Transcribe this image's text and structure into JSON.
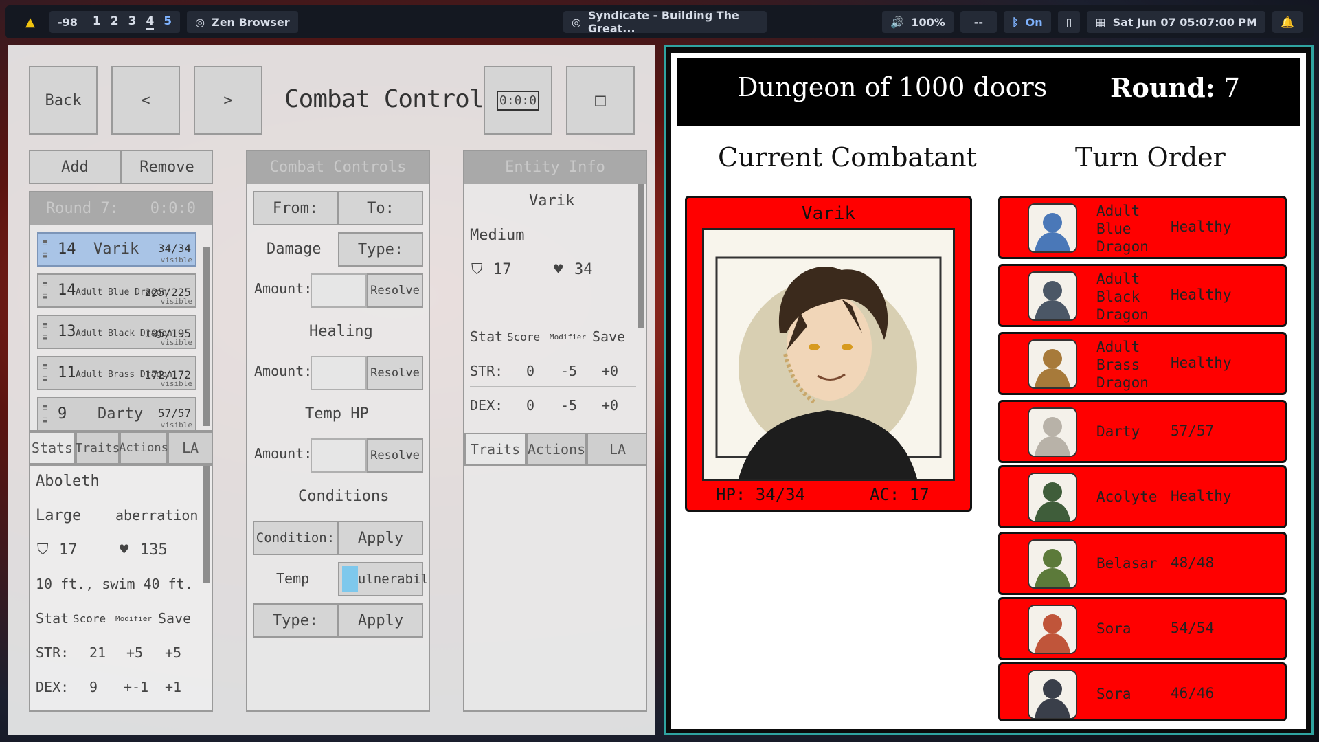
{
  "topbar": {
    "workspace_offset": "-98",
    "workspaces": [
      "1",
      "2",
      "3",
      "4",
      "5"
    ],
    "browser_label": "Zen Browser",
    "window_title": "Syndicate - Building The Great...",
    "volume": "100%",
    "net": "--",
    "bluetooth": "On",
    "datetime": "Sat Jun 07  05:07:00 PM"
  },
  "left": {
    "back": "Back",
    "prev": "<",
    "next": ">",
    "title": "Combat Control",
    "timer_icon_text": "0:0:0",
    "add": "Add",
    "remove": "Remove",
    "round_label": "Round 7:",
    "round_time": "0:0:0",
    "entities": [
      {
        "init": "14",
        "name": "Varik",
        "hp": "34/34",
        "visible": "visible",
        "selected": true
      },
      {
        "init": "14",
        "name": "Adult Blue Dragon",
        "hp": "225/225",
        "visible": "visible"
      },
      {
        "init": "13",
        "name": "Adult Black Dragon",
        "hp": "195/195",
        "visible": "visible"
      },
      {
        "init": "11",
        "name": "Adult Brass Dragon",
        "hp": "172/172",
        "visible": "visible"
      },
      {
        "init": "9",
        "name": "Darty",
        "hp": "57/57",
        "visible": "visible"
      }
    ],
    "tabs_left": [
      "Stats",
      "Traits",
      "Actions",
      "LA"
    ],
    "stats": {
      "name": "Aboleth",
      "size": "Large",
      "type": "aberration",
      "ac": "17",
      "hp": "135",
      "speed": "10 ft., swim 40 ft.",
      "head": [
        "Stat",
        "Score",
        "Modifier",
        "Save"
      ],
      "rows": [
        [
          "STR:",
          "21",
          "+5",
          "+5"
        ],
        [
          "DEX:",
          "9",
          "+-1",
          "+1"
        ]
      ]
    },
    "combat": {
      "head": "Combat Controls",
      "from": "From:",
      "to": "To:",
      "damage": "Damage",
      "type": "Type:",
      "amount": "Amount:",
      "resolve": "Resolve",
      "healing": "Healing",
      "temp_hp": "Temp HP",
      "conditions": "Conditions",
      "condition": "Condition:",
      "apply": "Apply",
      "temp_vuln_a": "Temp",
      "temp_vuln_b": "ulnerability",
      "type2": "Type:"
    },
    "entity": {
      "head": "Entity Info",
      "name": "Varik",
      "size": "Medium",
      "ac": "17",
      "hp": "34",
      "head_row": [
        "Stat",
        "Score",
        "Modifier",
        "Save"
      ],
      "rows": [
        [
          "STR:",
          "0",
          "-5",
          "+0"
        ],
        [
          "DEX:",
          "0",
          "-5",
          "+0"
        ]
      ],
      "tabs": [
        "Traits",
        "Actions",
        "LA"
      ]
    }
  },
  "right": {
    "title": "Dungeon of 1000 doors",
    "round_label": "Round:",
    "round_value": "7",
    "current_heading": "Current Combatant",
    "turn_heading": "Turn Order",
    "current": {
      "name": "Varik",
      "hp": "HP: 34/34",
      "ac": "AC: 17"
    },
    "turn_order": [
      {
        "name": "Adult\nBlue\nDragon",
        "status": "Healthy",
        "avatar": "blue-dragon",
        "color": "#4a78b8"
      },
      {
        "name": "Adult\nBlack\nDragon",
        "status": "Healthy",
        "avatar": "black-dragon",
        "color": "#4b5766"
      },
      {
        "name": "Adult\nBrass\nDragon",
        "status": "Healthy",
        "avatar": "brass-dragon",
        "color": "#a77a3a"
      },
      {
        "name": "Darty",
        "status": "57/57",
        "avatar": "tiefling",
        "color": "#b8b2a8"
      },
      {
        "name": "Acolyte",
        "status": "Healthy",
        "avatar": "silhouette",
        "color": "#3f5d3a"
      },
      {
        "name": "Belasar",
        "status": "48/48",
        "avatar": "orc",
        "color": "#5c7a3a"
      },
      {
        "name": "Sora",
        "status": "54/54",
        "avatar": "elf-red-hair",
        "color": "#c0553a"
      },
      {
        "name": "Sora",
        "status": "46/46",
        "avatar": "dark-hair",
        "color": "#3a3f4a"
      }
    ]
  }
}
